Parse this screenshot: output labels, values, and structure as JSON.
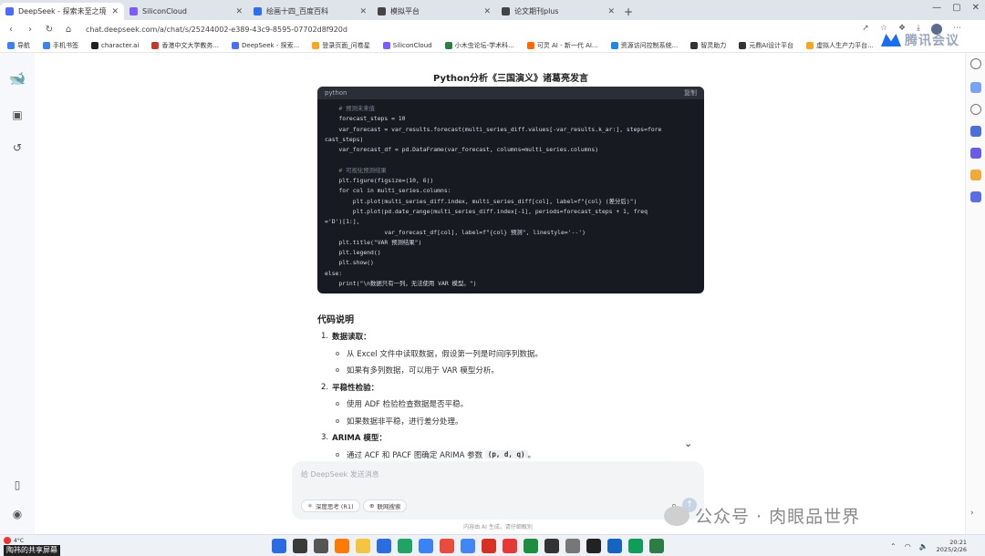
{
  "tabs": [
    {
      "label": "DeepSeek - 探索未至之境",
      "active": true,
      "color": "#4d6bfe"
    },
    {
      "label": "SiliconCloud",
      "active": false,
      "color": "#7b5cff"
    },
    {
      "label": "绘画十四_百度百科",
      "active": false,
      "color": "#2f6fed"
    },
    {
      "label": "模拟平台",
      "active": false,
      "color": "#444444"
    },
    {
      "label": "论文期刊plus",
      "active": false,
      "color": "#444444"
    }
  ],
  "url": "chat.deepseek.com/a/chat/s/25244002-e389-43c9-8595-07702d8f920d",
  "bookmarks": [
    {
      "label": "导航",
      "color": "#3b82f6"
    },
    {
      "label": "手机书签",
      "color": "#3b82f6"
    },
    {
      "label": "character.ai",
      "color": "#222222"
    },
    {
      "label": "香港中文大学教务...",
      "color": "#c0392b"
    },
    {
      "label": "DeepSeek - 探索...",
      "color": "#4d6bfe"
    },
    {
      "label": "登录页面_问卷星",
      "color": "#f5a623"
    },
    {
      "label": "SiliconCloud",
      "color": "#7b5cff"
    },
    {
      "label": "小木虫论坛-学术科...",
      "color": "#2d7d46"
    },
    {
      "label": "可灵 AI - 新一代 AI...",
      "color": "#ff6a00"
    },
    {
      "label": "资源访问控制系统...",
      "color": "#1e88e5"
    },
    {
      "label": "智灵助力",
      "color": "#333333"
    },
    {
      "label": "元鼎AI设计平台",
      "color": "#333333"
    },
    {
      "label": "虚拟人生产力平台...",
      "color": "#f5a623"
    }
  ],
  "watermark_top": "腾讯会议",
  "page_title": "Python分析《三国演义》诸葛亮发言",
  "code": {
    "language": "python",
    "copy_label": "复制",
    "lines": [
      {
        "text": "    # 预测未来值",
        "comment": true
      },
      {
        "text": "    forecast_steps = 10",
        "comment": false
      },
      {
        "text": "    var_forecast = var_results.forecast(multi_series_diff.values[-var_results.k_ar:], steps=fore",
        "comment": false
      },
      {
        "text": "cast_steps)",
        "comment": false
      },
      {
        "text": "    var_forecast_df = pd.DataFrame(var_forecast, columns=multi_series.columns)",
        "comment": false
      },
      {
        "text": "",
        "comment": false
      },
      {
        "text": "    # 可视化预测结果",
        "comment": true
      },
      {
        "text": "    plt.figure(figsize=(10, 6))",
        "comment": false
      },
      {
        "text": "    for col in multi_series.columns:",
        "comment": false
      },
      {
        "text": "        plt.plot(multi_series_diff.index, multi_series_diff[col], label=f\"{col} (差分后)\")",
        "comment": false
      },
      {
        "text": "        plt.plot(pd.date_range(multi_series_diff.index[-1], periods=forecast_steps + 1, freq",
        "comment": false
      },
      {
        "text": "='D')[1:],",
        "comment": false
      },
      {
        "text": "                 var_forecast_df[col], label=f\"{col} 预测\", linestyle='--')",
        "comment": false
      },
      {
        "text": "    plt.title(\"VAR 预测结果\")",
        "comment": false
      },
      {
        "text": "    plt.legend()",
        "comment": false
      },
      {
        "text": "    plt.show()",
        "comment": false
      },
      {
        "text": "else:",
        "comment": false
      },
      {
        "text": "    print(\"\\n数据只有一列，无法使用 VAR 模型。\")",
        "comment": false
      }
    ]
  },
  "explain_title": "代码说明",
  "explain": [
    {
      "type": "head",
      "num": "1.",
      "text": "数据读取："
    },
    {
      "type": "sub",
      "text": "从 Excel 文件中读取数据，假设第一列是时间序列数据。"
    },
    {
      "type": "sub",
      "text": "如果有多列数据，可以用于 VAR 模型分析。"
    },
    {
      "type": "head",
      "num": "2.",
      "text": "平稳性检验："
    },
    {
      "type": "sub",
      "text": "使用 ADF 检验检查数据是否平稳。"
    },
    {
      "type": "sub",
      "text": "如果数据非平稳，进行差分处理。"
    },
    {
      "type": "head",
      "num": "3.",
      "text": "ARIMA 模型："
    },
    {
      "type": "sub",
      "text": "通过 ACF 和 PACF 图确定 ARIMA 参数",
      "code": "(p, d, q)",
      "suffix": "。"
    }
  ],
  "composer": {
    "placeholder": "给 DeepSeek 发送消息",
    "deep_think": "深度思考 (R1)",
    "web_search": "联网搜索"
  },
  "footer_note": "内容由 AI 生成，请仔细甄别",
  "wechat_watermark": "公众号 · 肉眼品世界",
  "taskbar": {
    "temp": "4°C",
    "share_label": "陶祎的共享屏幕",
    "time": "20:21",
    "date": "2025/2/26",
    "apps": [
      "#2b6de0",
      "#3a3a3a",
      "#555555",
      "#ff7a00",
      "#f5c542",
      "#2b6de0",
      "#1fa463",
      "#3b82f6",
      "#e74c3c",
      "#4285f4",
      "#d93025",
      "#e53935",
      "#1e8e3e",
      "#333333",
      "#777777",
      "#222222",
      "#1565c0",
      "#0f9d58",
      "#2d7d46"
    ]
  }
}
